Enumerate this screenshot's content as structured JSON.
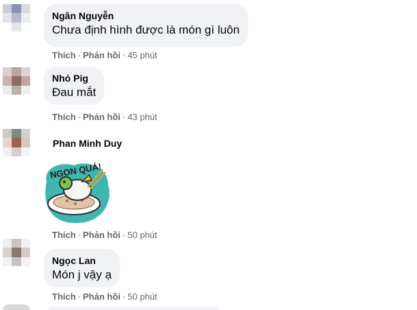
{
  "comments": [
    {
      "author": "Ngân Nguyễn",
      "text": "Chưa định hình được là món gì luôn",
      "like": "Thích",
      "reply": "Phản hồi",
      "time": "45 phút"
    },
    {
      "author": "Nhỏ Pig",
      "text": "Đau mắt",
      "like": "Thích",
      "reply": "Phản hồi",
      "time": "43 phút"
    },
    {
      "author": "Phan Minh Duy",
      "sticker_text": "NGON QUÁ!",
      "like": "Thích",
      "reply": "Phản hồi",
      "time": "50 phút"
    },
    {
      "author": "Ngọc Lan",
      "text": "Món j vậy ạ",
      "like": "Thích",
      "reply": "Phản hồi",
      "time": "50 phút"
    }
  ],
  "separator": "·",
  "colors": {
    "bubble": "#f0f2f5",
    "meta": "#65676b",
    "text": "#050505",
    "sticker_teal": "#3fb6b0"
  }
}
